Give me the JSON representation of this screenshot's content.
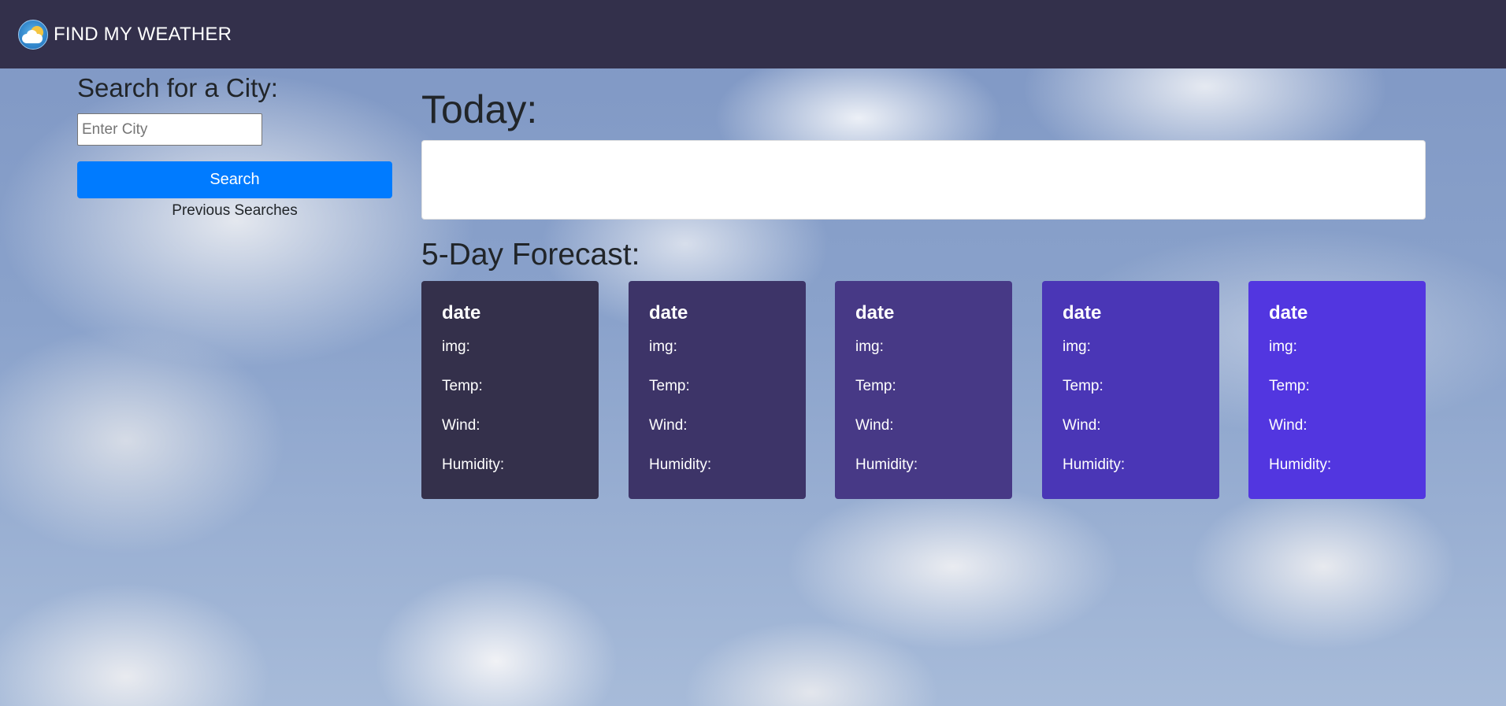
{
  "navbar": {
    "title": "FIND MY WEATHER",
    "logo_icon": "weather-sun-cloud-icon",
    "background": "#33304b"
  },
  "search": {
    "heading": "Search for a City:",
    "placeholder": "Enter City",
    "value": "",
    "button_label": "Search",
    "button_color": "#007bff",
    "previous_label": "Previous Searches"
  },
  "today": {
    "heading": "Today:"
  },
  "forecast": {
    "heading": "5-Day Forecast:",
    "cards": [
      {
        "date": "date",
        "img": "img:",
        "temp": "Temp:",
        "wind": "Wind:",
        "humidity": "Humidity:",
        "color": "#34304b"
      },
      {
        "date": "date",
        "img": "img:",
        "temp": "Temp:",
        "wind": "Wind:",
        "humidity": "Humidity:",
        "color": "#3d3468"
      },
      {
        "date": "date",
        "img": "img:",
        "temp": "Temp:",
        "wind": "Wind:",
        "humidity": "Humidity:",
        "color": "#473986"
      },
      {
        "date": "date",
        "img": "img:",
        "temp": "Temp:",
        "wind": "Wind:",
        "humidity": "Humidity:",
        "color": "#4a36b6"
      },
      {
        "date": "date",
        "img": "img:",
        "temp": "Temp:",
        "wind": "Wind:",
        "humidity": "Humidity:",
        "color": "#5236e0"
      }
    ]
  }
}
